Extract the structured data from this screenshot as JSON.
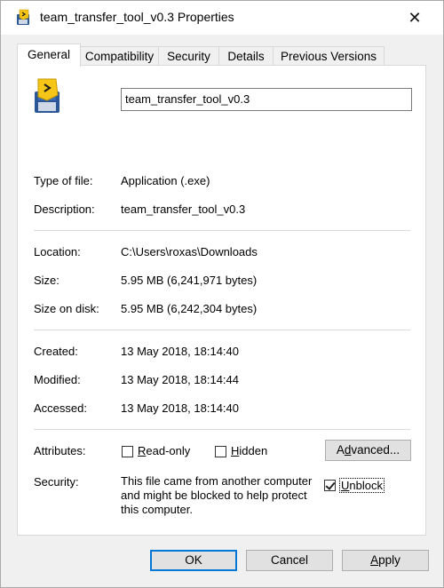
{
  "window": {
    "title": "team_transfer_tool_v0.3 Properties",
    "close_glyph": "✕"
  },
  "tabs": [
    {
      "label": "General",
      "active": true
    },
    {
      "label": "Compatibility",
      "active": false
    },
    {
      "label": "Security",
      "active": false
    },
    {
      "label": "Details",
      "active": false
    },
    {
      "label": "Previous Versions",
      "active": false
    }
  ],
  "general": {
    "file_name": "team_transfer_tool_v0.3",
    "type_of_file_label": "Type of file:",
    "type_of_file": "Application (.exe)",
    "description_label": "Description:",
    "description": "team_transfer_tool_v0.3",
    "location_label": "Location:",
    "location": "C:\\Users\\roxas\\Downloads",
    "size_label": "Size:",
    "size": "5.95 MB (6,241,971 bytes)",
    "size_on_disk_label": "Size on disk:",
    "size_on_disk": "5.95 MB (6,242,304 bytes)",
    "created_label": "Created:",
    "created": "13 May 2018, 18:14:40",
    "modified_label": "Modified:",
    "modified": "13 May 2018, 18:14:44",
    "accessed_label": "Accessed:",
    "accessed": "13 May 2018, 18:14:40",
    "attributes_label": "Attributes:",
    "readonly": {
      "label_u": "R",
      "label_rest": "ead-only",
      "checked": false
    },
    "hidden": {
      "label_u": "H",
      "label_rest": "idden",
      "checked": false
    },
    "advanced": {
      "label_pre": "A",
      "label_u": "d",
      "label_rest": "vanced..."
    },
    "security_label": "Security:",
    "security_line1": "This file came from another computer",
    "security_line2": "and might be blocked to help protect",
    "security_line3": "this computer.",
    "unblock": {
      "label_u": "U",
      "label_rest": "nblock",
      "checked": true
    }
  },
  "footer": {
    "ok": "OK",
    "cancel": "Cancel",
    "apply_u": "A",
    "apply_rest": "pply"
  },
  "colors": {
    "accent": "#0078d7",
    "icon_yellow": "#f5c518",
    "icon_blue": "#2b5797"
  }
}
